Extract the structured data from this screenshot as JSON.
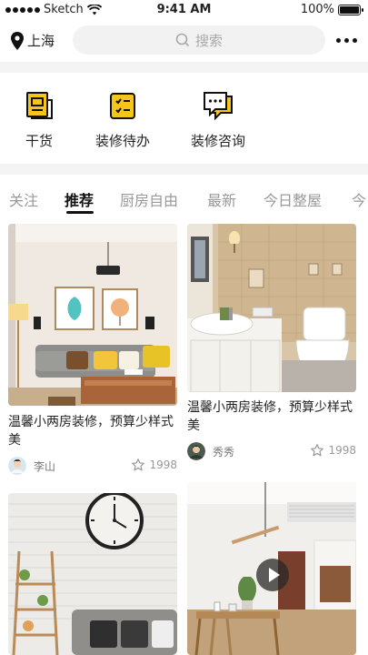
{
  "status_bar": {
    "carrier": "Sketch",
    "time": "9:41 AM",
    "battery": "100%"
  },
  "header": {
    "city": "上海",
    "search_placeholder": "搜索"
  },
  "quick_actions": [
    {
      "label": "干货",
      "icon": "notebook-icon"
    },
    {
      "label": "装修待办",
      "icon": "checklist-icon"
    },
    {
      "label": "装修咨询",
      "icon": "chat-bubble-icon"
    }
  ],
  "tabs": [
    "关注",
    "推荐",
    "厨房自由",
    "最新",
    "今日整屋",
    "今"
  ],
  "active_tab": "推荐",
  "cards": [
    {
      "title": "温馨小两房装修，预算少样式美",
      "author": "李山",
      "likes": "1998"
    },
    {
      "title": "温馨小两房装修，预算少样式美",
      "author": "秀秀",
      "likes": "1998"
    }
  ],
  "colors": {
    "accent": "#f5c518"
  }
}
